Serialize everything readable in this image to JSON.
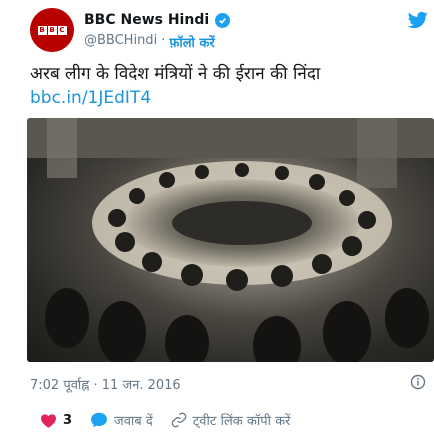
{
  "tweet": {
    "avatar_logo": [
      "B",
      "B",
      "C"
    ],
    "display_name": "BBC News Hindi",
    "handle": "@BBCHindi",
    "separator": "·",
    "follow_label": "फ़ॉलो करें",
    "text": "अरब लीग के विदेश मंत्रियों ने की ईरान की निंदा",
    "link": "bbc.in/1JEdIT4",
    "timestamp": "7:02 पूर्वाह्न · 11 जन. 2016",
    "actions": {
      "likes_count": "3",
      "reply_label": "जवाब दें",
      "copy_link_label": "ट्वीट लिंक कॉपी करें"
    }
  },
  "colors": {
    "brand_red": "#b80000",
    "twitter_blue": "#1da1f2",
    "link_blue": "#1b95e0",
    "heart_red": "#e0245e",
    "muted_gray": "#657786"
  },
  "icons": [
    "verified-icon",
    "twitter-bird-icon",
    "info-icon",
    "heart-icon",
    "reply-icon",
    "link-icon"
  ]
}
